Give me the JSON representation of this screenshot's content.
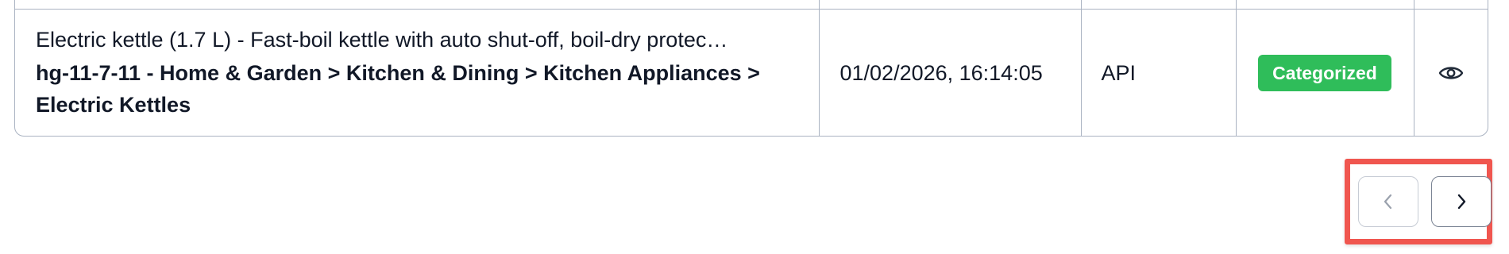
{
  "row": {
    "description": "Electric kettle (1.7 L) - Fast-boil kettle with auto shut-off, boil-dry protec…",
    "category": "hg-11-7-11 - Home & Garden > Kitchen & Dining > Kitchen Appliances > Electric Kettles",
    "date": "01/02/2026, 16:14:05",
    "source": "API",
    "status": "Categorized",
    "action_icon": "eye-icon"
  },
  "pagination": {
    "prev_icon": "chevron-left-icon",
    "next_icon": "chevron-right-icon",
    "prev_enabled": false,
    "next_enabled": true
  },
  "colors": {
    "badge": "#2fbd5a",
    "highlight": "#f0564f",
    "border": "#aab3c2"
  }
}
